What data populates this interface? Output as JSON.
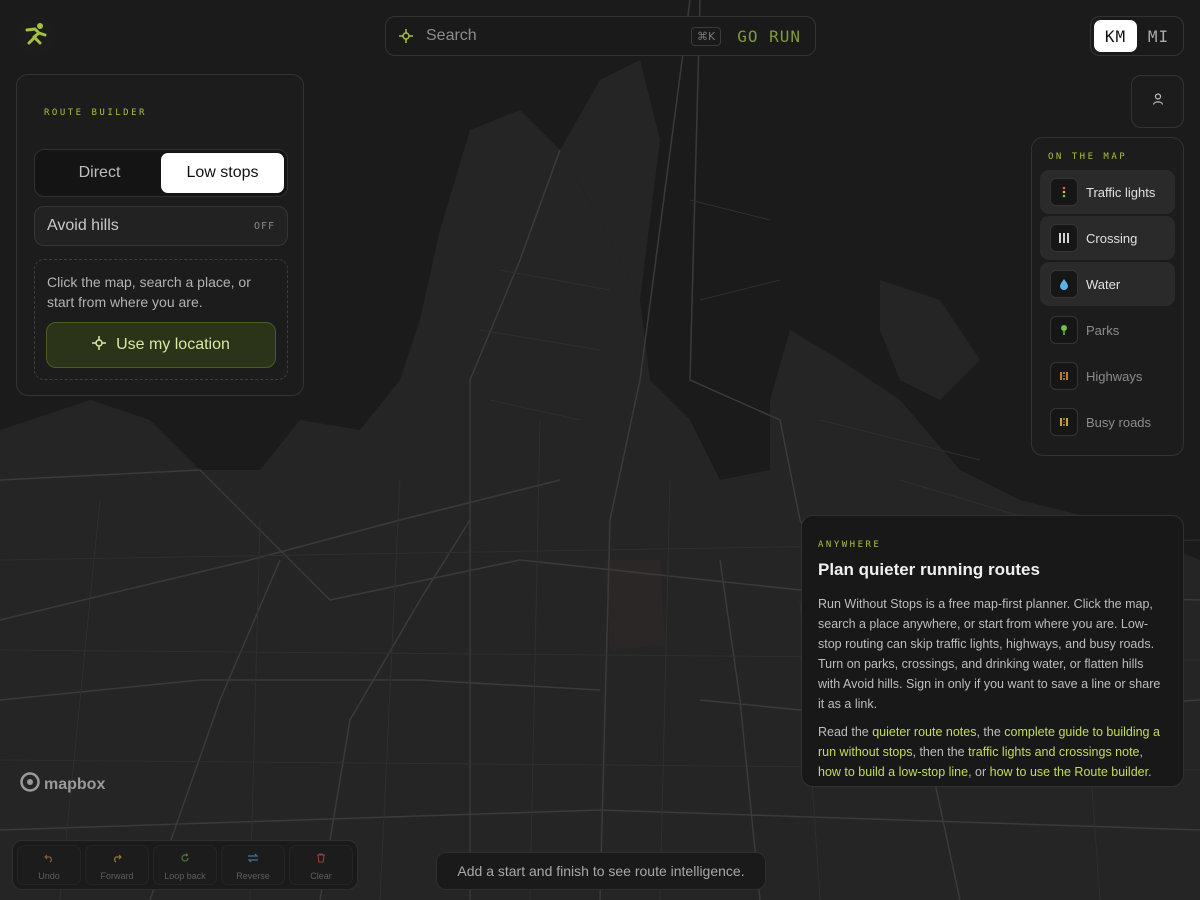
{
  "app": {
    "logo_icon": "runner-icon"
  },
  "search": {
    "placeholder": "Search",
    "shortcut": "⌘K",
    "go_label": "GO RUN"
  },
  "units": {
    "km": "KM",
    "mi": "MI",
    "selected": "KM"
  },
  "route_builder": {
    "eyebrow": "ROUTE BUILDER",
    "modes": [
      "Direct",
      "Low stops"
    ],
    "selected_mode": "Low stops",
    "avoid_hills": {
      "label": "Avoid hills",
      "state": "OFF"
    },
    "hint": "Click the map, search a place, or start from where you are.",
    "location_button": "Use my location"
  },
  "layers": {
    "eyebrow": "ON THE MAP",
    "items": [
      {
        "label": "Traffic lights",
        "icon": "traffic-light-icon",
        "on": true
      },
      {
        "label": "Crossing",
        "icon": "crossing-icon",
        "on": true
      },
      {
        "label": "Water",
        "icon": "water-drop-icon",
        "on": true
      },
      {
        "label": "Parks",
        "icon": "tree-icon",
        "on": false
      },
      {
        "label": "Highways",
        "icon": "highway-icon",
        "on": false
      },
      {
        "label": "Busy roads",
        "icon": "busy-road-icon",
        "on": false
      }
    ]
  },
  "info": {
    "eyebrow": "ANYWHERE",
    "title": "Plan quieter running routes",
    "body": "Run Without Stops is a free map-first planner. Click the map, search a place anywhere, or start from where you are. Low-stop routing can skip traffic lights, highways, and busy roads. Turn on parks, crossings, and drinking water, or flatten hills with Avoid hills. Sign in only if you want to save a line or share it as a link.",
    "links_prefix": "Read the ",
    "link1": "quieter route notes",
    "sep1": ", the ",
    "link2": "complete guide to building a run without stops",
    "sep2": ", then the ",
    "link3": "traffic lights and crossings note",
    "sep3": ", ",
    "link4": "how to build a low-stop line",
    "sep4": ", or ",
    "link5": "how to use the Route builder",
    "suffix": "."
  },
  "attribution": {
    "label": "mapbox"
  },
  "toolbar": {
    "undo": "Undo",
    "forward": "Forward",
    "loop_back": "Loop back",
    "reverse": "Reverse",
    "clear": "Clear"
  },
  "status": {
    "text": "Add a start and finish to see route intelligence."
  },
  "colors": {
    "accent": "#a5c23f",
    "map_bg": "#232323",
    "water": "#181818"
  }
}
